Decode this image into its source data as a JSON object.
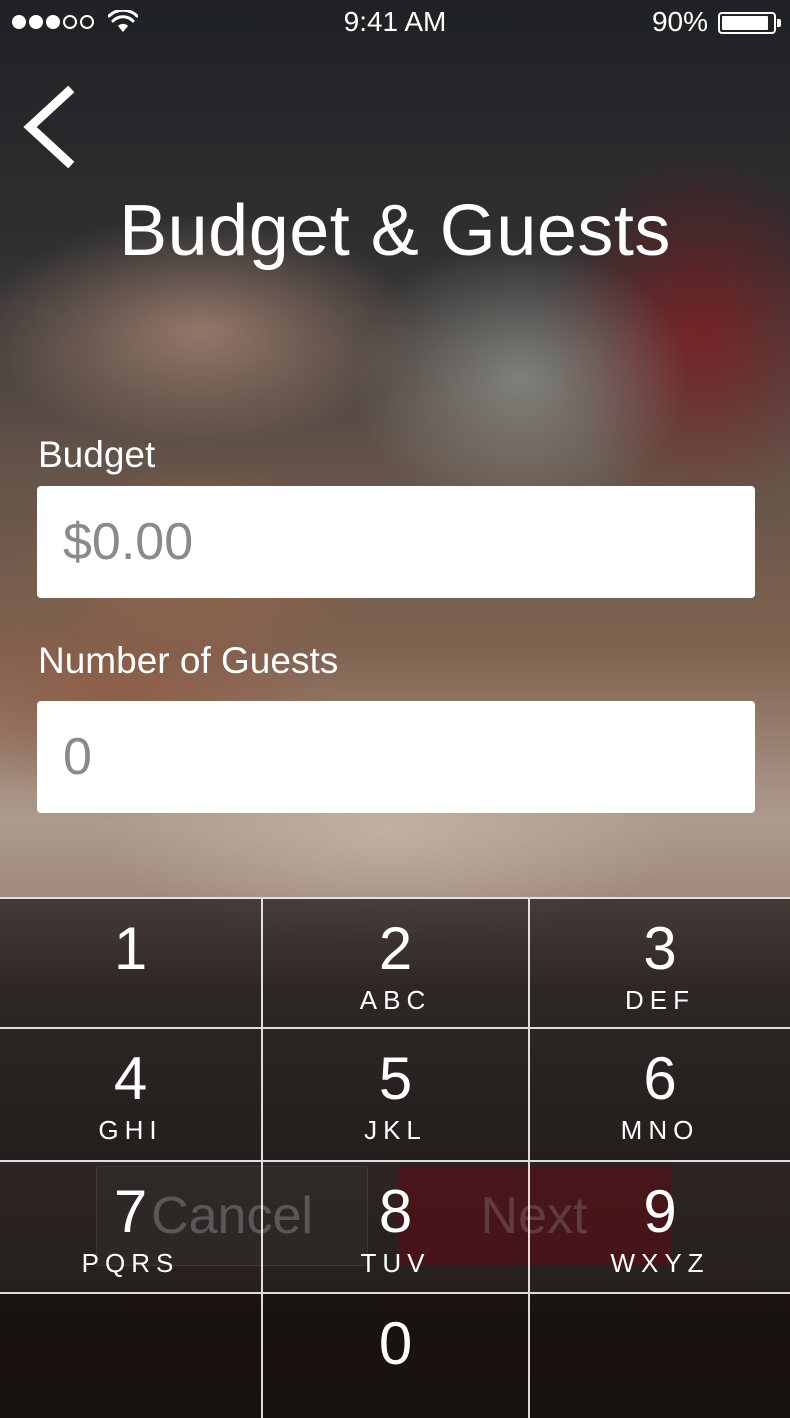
{
  "status_bar": {
    "time": "9:41 AM",
    "battery_percent": "90%",
    "signal_strength": 3,
    "signal_total": 5
  },
  "header": {
    "back_icon": "chevron-left-icon",
    "title": "Budget & Guests"
  },
  "form": {
    "budget_label": "Budget",
    "budget_placeholder": "$0.00",
    "guests_label": "Number of Guests",
    "guests_placeholder": "0"
  },
  "actions": {
    "cancel_label": "Cancel",
    "next_label": "Next",
    "next_color": "#6e0c16"
  },
  "keypad": {
    "keys": [
      {
        "num": "1",
        "letters": ""
      },
      {
        "num": "2",
        "letters": "ABC"
      },
      {
        "num": "3",
        "letters": "DEF"
      },
      {
        "num": "4",
        "letters": "GHI"
      },
      {
        "num": "5",
        "letters": "JKL"
      },
      {
        "num": "6",
        "letters": "MNO"
      },
      {
        "num": "7",
        "letters": "PQRS"
      },
      {
        "num": "8",
        "letters": "TUV"
      },
      {
        "num": "9",
        "letters": "WXYZ"
      },
      {
        "num": "0",
        "letters": ""
      }
    ]
  }
}
